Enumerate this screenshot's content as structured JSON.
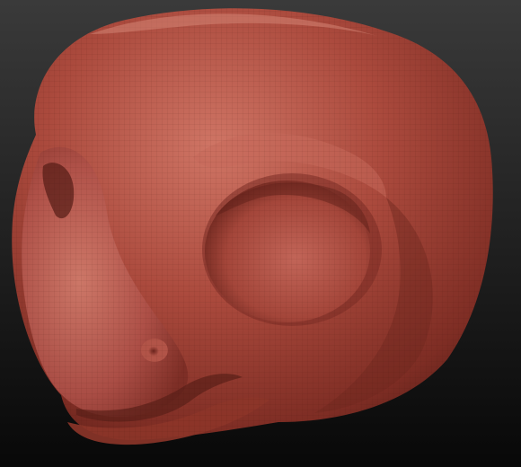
{
  "viewport": {
    "background_top": "#3a3a3a",
    "background_bottom": "#080808"
  },
  "model": {
    "subject": "sculpted-reptile-head",
    "material_color": "#a8473b",
    "material_highlight": "#cf7565",
    "material_shadow": "#5a1f18",
    "wireframe_overlay": true
  }
}
